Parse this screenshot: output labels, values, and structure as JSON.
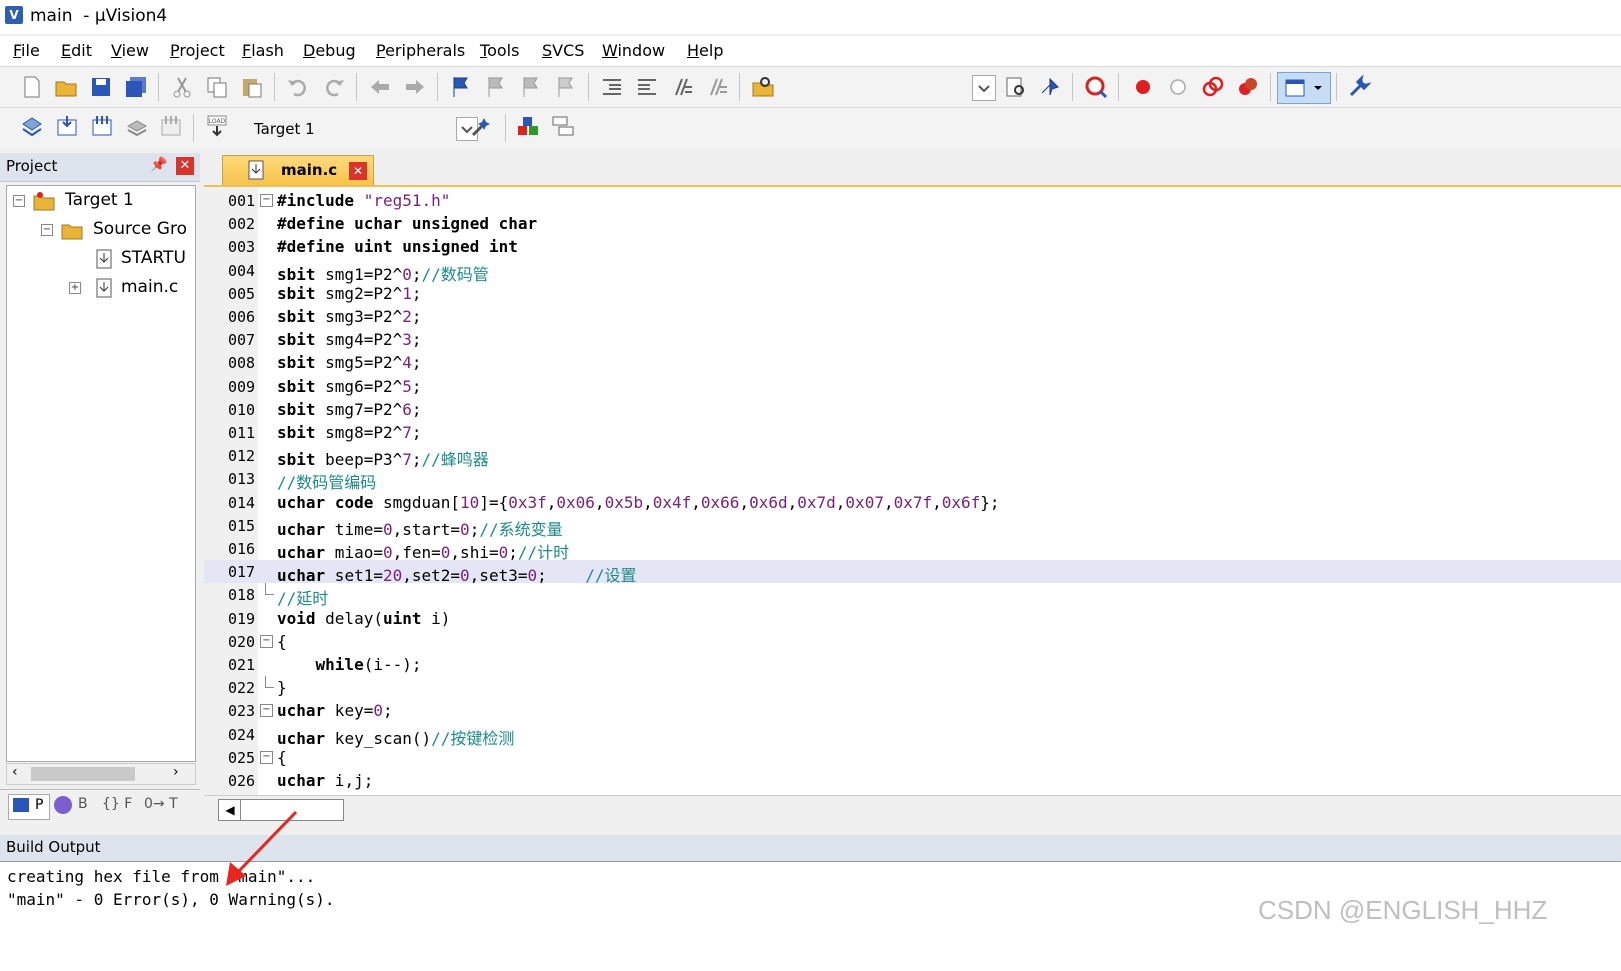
{
  "window": {
    "title": "main  - µVision4"
  },
  "menu": [
    "File",
    "Edit",
    "View",
    "Project",
    "Flash",
    "Debug",
    "Peripherals",
    "Tools",
    "SVCS",
    "Window",
    "Help"
  ],
  "toolbar2": {
    "target": "Target 1"
  },
  "project_panel": {
    "title": "Project",
    "tree": [
      "Target 1",
      "Source Gro",
      "STARTU",
      "main.c"
    ],
    "tabs": [
      "P",
      "B",
      "{} F",
      "0→ T"
    ]
  },
  "editor": {
    "tab": "main.c",
    "highlight_line": "017",
    "lines": [
      {
        "n": "001",
        "code": "#include \"reg51.h\""
      },
      {
        "n": "002",
        "code": "#define uchar unsigned char"
      },
      {
        "n": "003",
        "code": "#define uint unsigned int"
      },
      {
        "n": "004",
        "code": "sbit smg1=P2^0;//数码管"
      },
      {
        "n": "005",
        "code": "sbit smg2=P2^1;"
      },
      {
        "n": "006",
        "code": "sbit smg3=P2^2;"
      },
      {
        "n": "007",
        "code": "sbit smg4=P2^3;"
      },
      {
        "n": "008",
        "code": "sbit smg5=P2^4;"
      },
      {
        "n": "009",
        "code": "sbit smg6=P2^5;"
      },
      {
        "n": "010",
        "code": "sbit smg7=P2^6;"
      },
      {
        "n": "011",
        "code": "sbit smg8=P2^7;"
      },
      {
        "n": "012",
        "code": "sbit beep=P3^7;//蜂鸣器"
      },
      {
        "n": "013",
        "code": "//数码管编码"
      },
      {
        "n": "014",
        "code": "uchar code smgduan[10]={0x3f,0x06,0x5b,0x4f,0x66,0x6d,0x7d,0x07,0x7f,0x6f};"
      },
      {
        "n": "015",
        "code": "uchar time=0,start=0;//系统变量"
      },
      {
        "n": "016",
        "code": "uchar miao=0,fen=0,shi=0;//计时"
      },
      {
        "n": "017",
        "code": "uchar set1=20,set2=0,set3=0;    //设置"
      },
      {
        "n": "018",
        "code": "//延时"
      },
      {
        "n": "019",
        "code": "void delay(uint i)"
      },
      {
        "n": "020",
        "code": "{"
      },
      {
        "n": "021",
        "code": "    while(i--);"
      },
      {
        "n": "022",
        "code": "}"
      },
      {
        "n": "023",
        "code": "uchar key=0;"
      },
      {
        "n": "024",
        "code": "uchar key_scan()//按键检测"
      },
      {
        "n": "025",
        "code": "{"
      },
      {
        "n": "026",
        "code": "uchar i,j;"
      }
    ]
  },
  "build_output": {
    "title": "Build Output",
    "lines": [
      "creating hex file from \"main\"...",
      "\"main\" - 0 Error(s), 0 Warning(s)."
    ]
  },
  "watermark": "CSDN @ENGLISH_HHZ",
  "colors": {
    "keyword": "#000000",
    "comment": "#1e8a8a",
    "string": "#7a1f7a",
    "tab_active": "#f6c34a",
    "highlight": "#e4e6f5",
    "arrow": "#e8261f"
  }
}
